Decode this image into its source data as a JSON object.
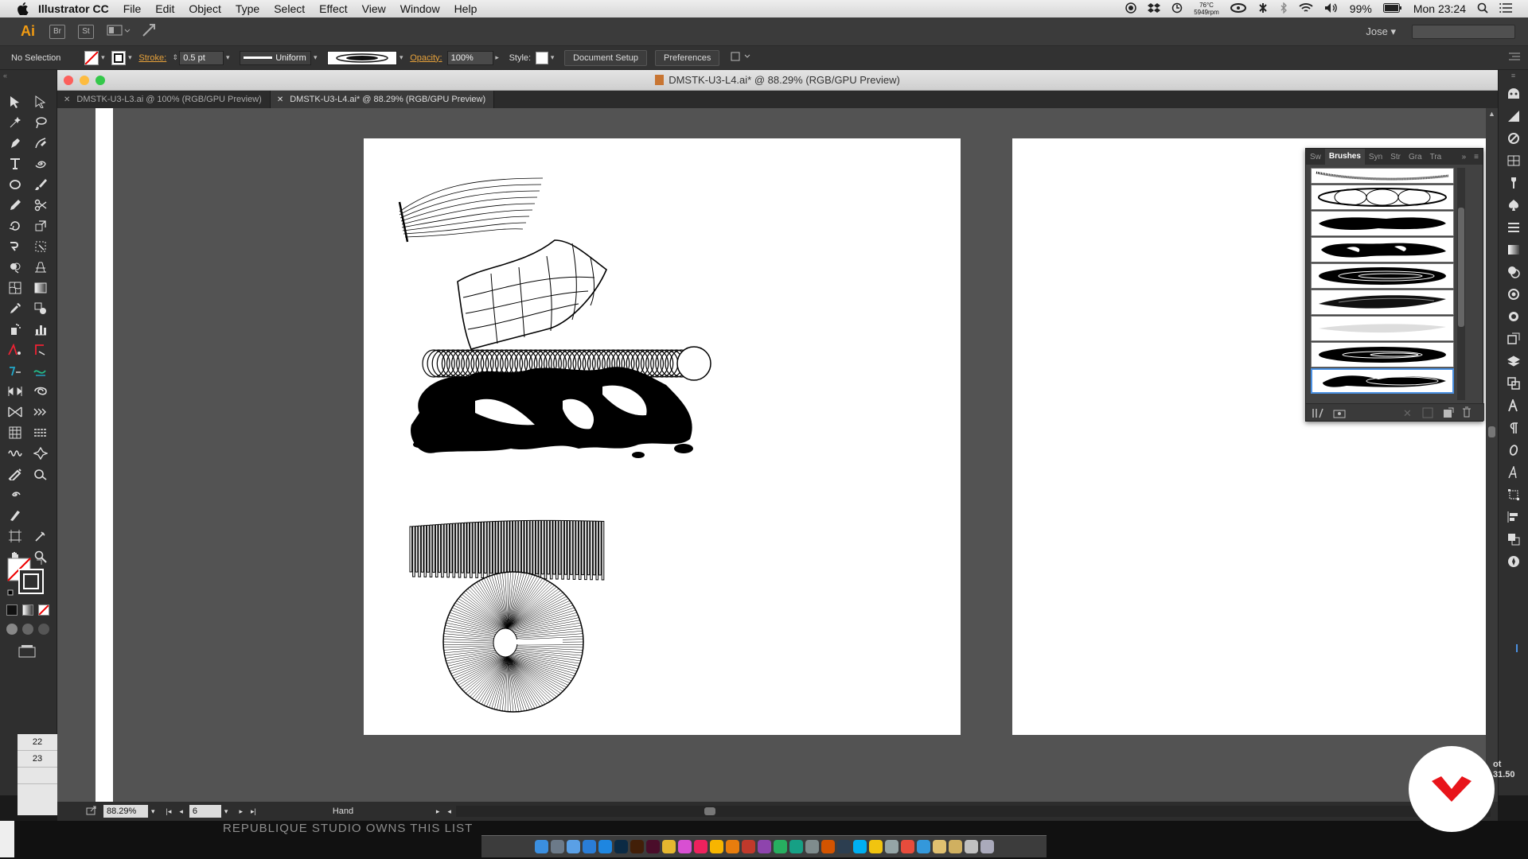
{
  "menubar": {
    "app_name": "Illustrator CC",
    "items": [
      "File",
      "Edit",
      "Object",
      "Type",
      "Select",
      "Effect",
      "View",
      "Window",
      "Help"
    ],
    "temperature": "76°C",
    "fan": "5949rpm",
    "battery": "99%",
    "clock": "Mon 23:24"
  },
  "appbar": {
    "logo": "Ai",
    "bridge": "Br",
    "stock": "St",
    "user": "Jose"
  },
  "control": {
    "selection": "No Selection",
    "stroke_label": "Stroke:",
    "stroke_value": "0.5 pt",
    "profile": "Uniform",
    "opacity_label": "Opacity:",
    "opacity_value": "100%",
    "style_label": "Style:",
    "document_setup": "Document Setup",
    "preferences": "Preferences"
  },
  "document": {
    "title": "DMSTK-U3-L4.ai* @ 88.29% (RGB/GPU Preview)",
    "tabs": [
      {
        "label": "DMSTK-U3-L3.ai @ 100% (RGB/GPU Preview)"
      },
      {
        "label": "DMSTK-U3-L4.ai* @ 88.29% (RGB/GPU Preview)"
      }
    ]
  },
  "layers": {
    "rows": [
      "22",
      "23"
    ]
  },
  "status": {
    "zoom": "88.29%",
    "artboard": "6",
    "tool": "Hand"
  },
  "brushes_panel": {
    "tabs": [
      "Sw",
      "Brushes",
      "Syn",
      "Str",
      "Gra",
      "Tra"
    ]
  },
  "side_info": {
    "line1": "ot",
    "line2": "31.50"
  },
  "watermark": "REPUBLIQUE STUDIO OWNS THIS LIST",
  "colors": {
    "accent": "#e7a23b",
    "close": "#fc605c",
    "min": "#fdbc40",
    "max": "#34c84a",
    "logo_red": "#e8141a"
  }
}
